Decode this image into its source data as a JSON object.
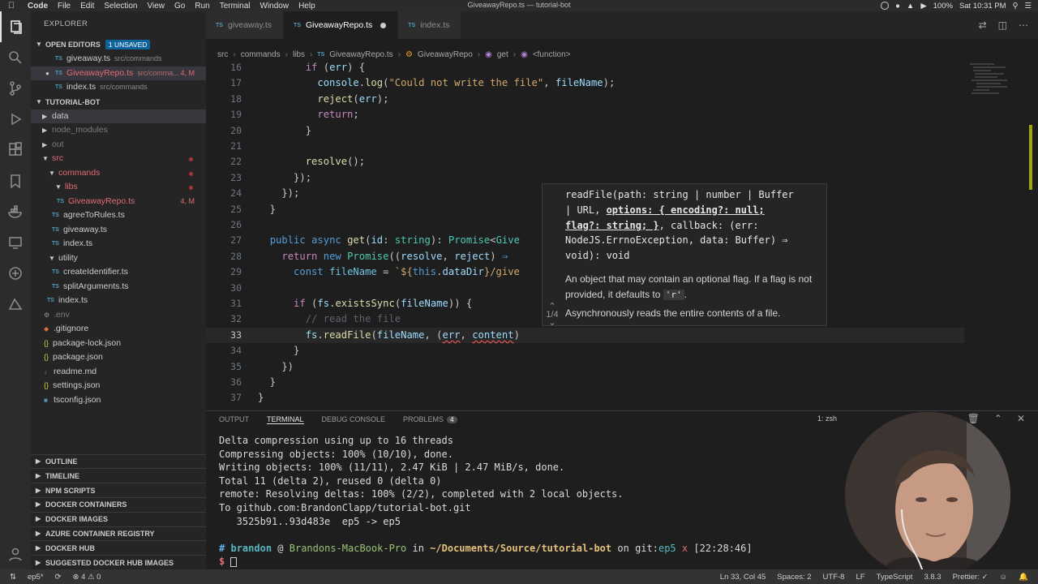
{
  "menubar": {
    "app": "Code",
    "items": [
      "File",
      "Edit",
      "Selection",
      "View",
      "Go",
      "Run",
      "Terminal",
      "Window",
      "Help"
    ],
    "window_title": "GiveawayRepo.ts — tutorial-bot",
    "battery": "100%",
    "clock": "Sat 10:31 PM"
  },
  "sidebar": {
    "title": "EXPLORER",
    "open_editors": {
      "label": "OPEN EDITORS",
      "badge": "1 UNSAVED",
      "items": [
        {
          "name": "giveaway.ts",
          "path": "src/commands"
        },
        {
          "name": "GiveawayRepo.ts",
          "path": "src/comma...",
          "status": "4, M"
        },
        {
          "name": "index.ts",
          "path": "src/commands"
        }
      ]
    },
    "project": {
      "label": "TUTORIAL-BOT",
      "tree": [
        {
          "name": "data"
        },
        {
          "name": "node_modules"
        },
        {
          "name": "out"
        },
        {
          "name": "src"
        },
        {
          "name": "commands"
        },
        {
          "name": "libs"
        },
        {
          "name": "GiveawayRepo.ts",
          "status": "4, M"
        },
        {
          "name": "agreeToRules.ts"
        },
        {
          "name": "giveaway.ts"
        },
        {
          "name": "index.ts"
        },
        {
          "name": "utility"
        },
        {
          "name": "createIdentifier.ts"
        },
        {
          "name": "splitArguments.ts"
        },
        {
          "name": "index.ts"
        },
        {
          "name": ".env"
        },
        {
          "name": ".gitignore"
        },
        {
          "name": "package-lock.json"
        },
        {
          "name": "package.json"
        },
        {
          "name": "readme.md"
        },
        {
          "name": "settings.json"
        },
        {
          "name": "tsconfig.json"
        }
      ]
    },
    "bottom_sections": [
      "OUTLINE",
      "TIMELINE",
      "NPM SCRIPTS",
      "DOCKER CONTAINERS",
      "DOCKER IMAGES",
      "AZURE CONTAINER REGISTRY",
      "DOCKER HUB",
      "SUGGESTED DOCKER HUB IMAGES"
    ]
  },
  "tabs": [
    {
      "label": "giveaway.ts"
    },
    {
      "label": "GiveawayRepo.ts"
    },
    {
      "label": "index.ts"
    }
  ],
  "breadcrumb": [
    "src",
    "commands",
    "libs",
    "GiveawayRepo.ts",
    "GiveawayRepo",
    "get",
    "<function>"
  ],
  "editor": {
    "line_numbers": [
      "16",
      "17",
      "18",
      "19",
      "20",
      "21",
      "22",
      "23",
      "24",
      "25",
      "26",
      "27",
      "28",
      "29",
      "30",
      "31",
      "32",
      "33",
      "34",
      "35",
      "36",
      "37"
    ]
  },
  "hover": {
    "page": "1/4",
    "sig_1": "readFile(path: string | number | Buffer",
    "sig_2a": "| URL, ",
    "sig_2b": "options: { encoding?: null;",
    "sig_3a": "flag?: string; }",
    "sig_3b": ", callback: (err:",
    "sig_4": "NodeJS.ErrnoException, data: Buffer) ⇒",
    "sig_5": "void): void",
    "desc_a": "An object that may contain an optional flag. If a flag is not provided, it defaults to ",
    "desc_code": "'r'",
    "desc_b": ".",
    "desc2": "Asynchronously reads the entire contents of a file."
  },
  "panel": {
    "tabs": [
      "OUTPUT",
      "TERMINAL",
      "DEBUG CONSOLE",
      "PROBLEMS"
    ],
    "problems_count": "4",
    "terminal_select": "1: zsh",
    "terminal_lines": [
      "Delta compression using up to 16 threads",
      "Compressing objects: 100% (10/10), done.",
      "Writing objects: 100% (11/11), 2.47 KiB | 2.47 MiB/s, done.",
      "Total 11 (delta 2), reused 0 (delta 0)",
      "remote: Resolving deltas: 100% (2/2), completed with 2 local objects.",
      "To github.com:BrandonClapp/tutorial-bot.git",
      "   3525b91..93d483e  ep5 -> ep5"
    ],
    "prompt": {
      "hash": "#",
      "user": "brandon",
      "at": "@",
      "host": "Brandons-MacBook-Pro",
      "in": "in",
      "dir": "~/Documents/Source/tutorial-bot",
      "on": "on",
      "git": "git:",
      "branch": "ep5",
      "x": "x",
      "time": "[22:28:46]",
      "dollar": "$"
    }
  },
  "status": {
    "branch": "ep5*",
    "problems": "⊗ 4 ⚠ 0",
    "position": "Ln 33, Col 45",
    "spaces": "Spaces: 2",
    "encoding": "UTF-8",
    "eol": "LF",
    "language": "TypeScript",
    "version": "3.8.3",
    "formatter": "Prettier: ✓"
  }
}
